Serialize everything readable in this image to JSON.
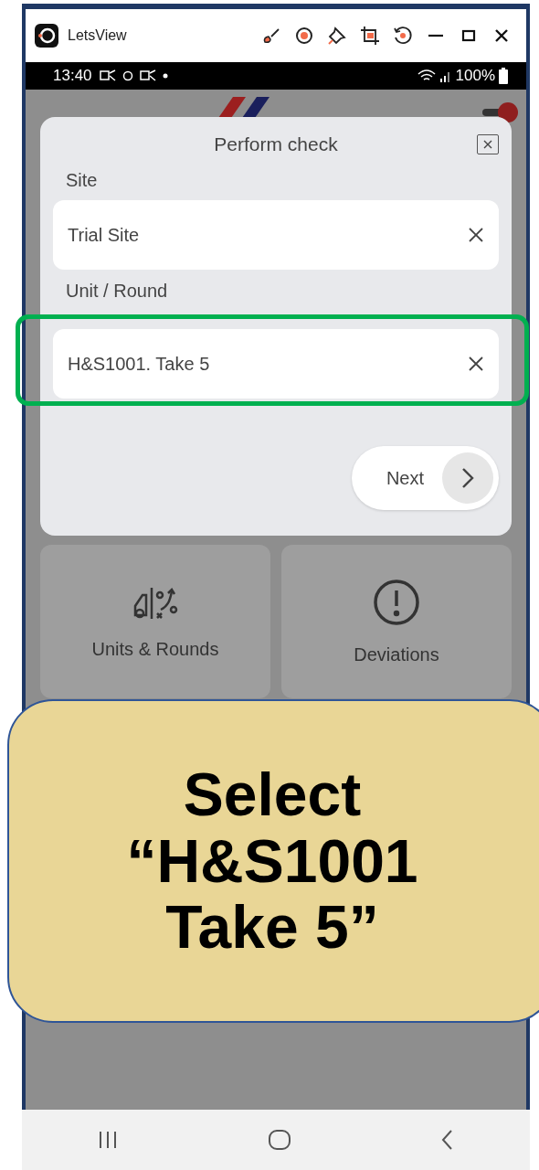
{
  "window": {
    "title": "LetsView"
  },
  "status_bar": {
    "time": "13:40",
    "battery": "100%"
  },
  "dialog": {
    "title": "Perform check",
    "fields": [
      {
        "label": "Site",
        "value": "Trial Site",
        "highlighted": false
      },
      {
        "label": "Unit / Round",
        "value": "H&S1001. Take 5",
        "highlighted": true
      }
    ],
    "next_button": "Next"
  },
  "tiles": [
    {
      "kind": "units",
      "label": "Units & Rounds"
    },
    {
      "kind": "deviations",
      "label": "Deviations"
    }
  ],
  "callout": {
    "lines": [
      "Select",
      "“H&S1001",
      "Take 5”"
    ]
  }
}
